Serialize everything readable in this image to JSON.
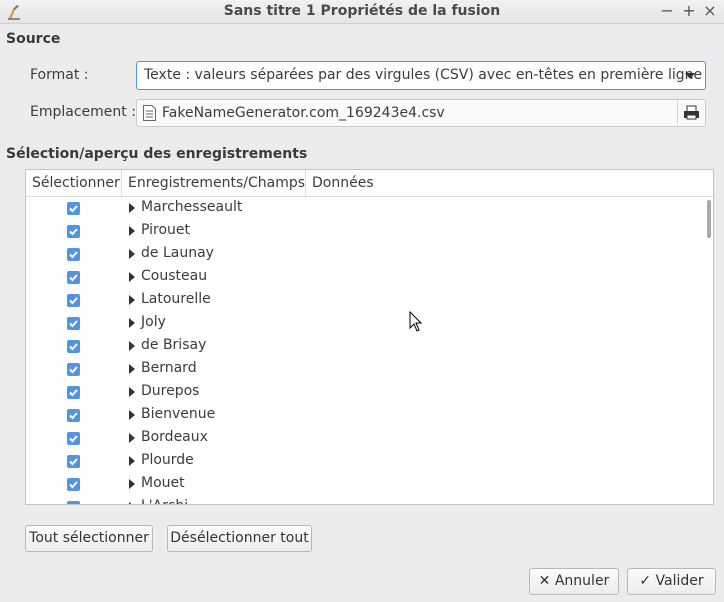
{
  "window": {
    "title": "Sans titre 1 Propriétés de la fusion",
    "controls": {
      "minimize": "−",
      "maximize": "+",
      "close": "×"
    }
  },
  "source": {
    "heading": "Source",
    "format_label": "Format :",
    "format_value": "Texte : valeurs séparées par des virgules (CSV) avec en-têtes en première ligne",
    "location_label": "Emplacement :",
    "location_value": "FakeNameGenerator.com_169243e4.csv"
  },
  "records": {
    "heading": "Sélection/aperçu des enregistrements",
    "columns": [
      "Sélectionner",
      "Enregistrements/Champs",
      "Données"
    ],
    "rows": [
      {
        "name": "Marchesseault",
        "checked": true
      },
      {
        "name": "Pirouet",
        "checked": true
      },
      {
        "name": "de Launay",
        "checked": true
      },
      {
        "name": "Cousteau",
        "checked": true
      },
      {
        "name": "Latourelle",
        "checked": true
      },
      {
        "name": "Joly",
        "checked": true
      },
      {
        "name": "de Brisay",
        "checked": true
      },
      {
        "name": "Bernard",
        "checked": true
      },
      {
        "name": "Durepos",
        "checked": true
      },
      {
        "name": "Bienvenue",
        "checked": true
      },
      {
        "name": "Bordeaux",
        "checked": true
      },
      {
        "name": "Plourde",
        "checked": true
      },
      {
        "name": "Mouet",
        "checked": true
      },
      {
        "name": "L'Archi",
        "checked": true
      }
    ]
  },
  "buttons": {
    "select_all": "Tout sélectionner",
    "deselect_all": "Désélectionner tout",
    "cancel": "Annuler",
    "ok": "Valider"
  },
  "colors": {
    "accent": "#5294e2",
    "background": "#ececec"
  }
}
